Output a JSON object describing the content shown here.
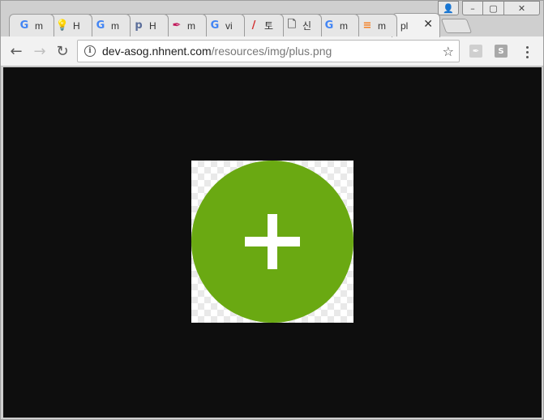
{
  "browser": {
    "tabs": [
      {
        "favicon": "google-g-icon",
        "favicon_text": "G",
        "favicon_color": "#4285F4",
        "title": "m"
      },
      {
        "favicon": "lightbulb-icon",
        "favicon_text": "💡",
        "favicon_color": "#f4c20d",
        "title": "H"
      },
      {
        "favicon": "google-g-icon",
        "favicon_text": "G",
        "favicon_color": "#4285F4",
        "title": "m"
      },
      {
        "favicon": "p-circle-icon",
        "favicon_text": "p",
        "favicon_color": "#5b6e9a",
        "title": "H"
      },
      {
        "favicon": "feather-icon",
        "favicon_text": "✒",
        "favicon_color": "#c2185b",
        "title": "m"
      },
      {
        "favicon": "google-g-icon",
        "favicon_text": "G",
        "favicon_color": "#4285F4",
        "title": "vi"
      },
      {
        "favicon": "pen-icon",
        "favicon_text": "/",
        "favicon_color": "#d32f2f",
        "title": "토"
      },
      {
        "favicon": "document-icon",
        "favicon_text": "🗋",
        "favicon_color": "#666666",
        "title": "신"
      },
      {
        "favicon": "google-g-icon",
        "favicon_text": "G",
        "favicon_color": "#4285F4",
        "title": "m"
      },
      {
        "favicon": "stackoverflow-icon",
        "favicon_text": "≡",
        "favicon_color": "#f48024",
        "title": "m"
      },
      {
        "favicon": "",
        "favicon_text": "",
        "favicon_color": "#333333",
        "title": "pl",
        "active": true
      }
    ],
    "active_tab_close": "✕",
    "caption": {
      "user": "👤",
      "minimize": "–",
      "maximize": "▢",
      "close": "✕"
    },
    "toolbar": {
      "back": "←",
      "forward": "→",
      "reload": "↻",
      "info": "i",
      "url_host": "dev-asog.nhnent.com",
      "url_path": "/resources/img/plus.png",
      "star": "☆",
      "ext_pdf": "✒",
      "ext_s": "S"
    }
  },
  "content": {
    "viewport_background": "#0e0e0e",
    "image_icon": "plus-icon",
    "plus_circle_color": "#6aa912"
  }
}
